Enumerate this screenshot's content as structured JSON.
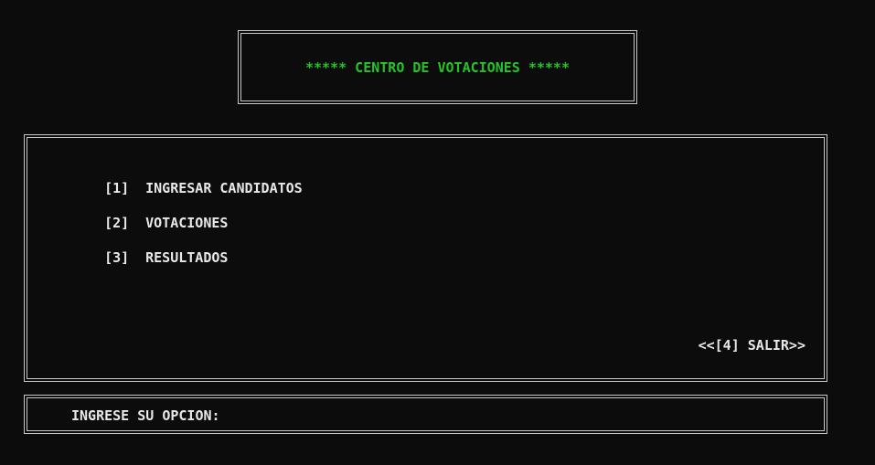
{
  "header": {
    "title": "***** CENTRO DE VOTACIONES *****"
  },
  "menu": {
    "items": [
      {
        "key": "[1]",
        "label": "INGRESAR CANDIDATOS"
      },
      {
        "key": "[2]",
        "label": "VOTACIONES"
      },
      {
        "key": "[3]",
        "label": "RESULTADOS"
      }
    ],
    "exit_label": "<<[4] SALIR>>"
  },
  "prompt": {
    "label": "INGRESE SU OPCION:",
    "value": ""
  },
  "colors": {
    "background": "#0c0c0c",
    "title": "#27c22a",
    "text": "#e8e8e8",
    "border": "#c8c8c8"
  }
}
